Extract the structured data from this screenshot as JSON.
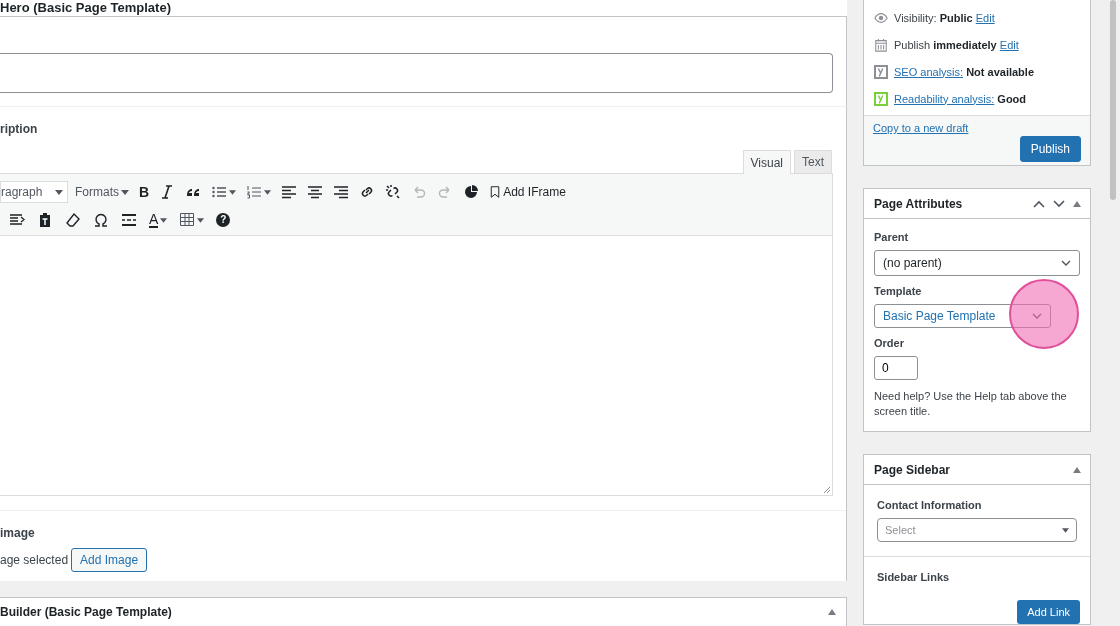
{
  "hero_section": {
    "title": "Hero (Basic Page Template)"
  },
  "description_field": {
    "label": "ription",
    "tabs": [
      {
        "label": "Visual",
        "selected": true
      },
      {
        "label": "Text",
        "selected": false
      }
    ],
    "format_select": "ragraph",
    "formats_menu": "Formats",
    "add_iframe": "Add IFrame",
    "toolbar_rows": [
      [
        {
          "kind": "bold",
          "label": "B",
          "disabled": false
        },
        {
          "kind": "italic",
          "disabled": false
        },
        {
          "kind": "quote",
          "disabled": false
        },
        {
          "kind": "bullets",
          "disabled": false
        },
        {
          "kind": "numbers",
          "disabled": false
        },
        {
          "kind": "align-left",
          "disabled": false
        },
        {
          "kind": "align-center",
          "disabled": false
        },
        {
          "kind": "align-right",
          "disabled": false
        },
        {
          "kind": "link",
          "disabled": false
        },
        {
          "kind": "unlink",
          "disabled": false
        },
        {
          "kind": "undo",
          "disabled": true
        },
        {
          "kind": "redo",
          "disabled": true
        },
        {
          "kind": "chart",
          "disabled": false
        }
      ],
      [
        {
          "kind": "indent",
          "disabled": false
        },
        {
          "kind": "paste",
          "disabled": false
        },
        {
          "kind": "eraser",
          "disabled": false
        },
        {
          "kind": "omega",
          "disabled": false
        },
        {
          "kind": "more",
          "disabled": false
        },
        {
          "kind": "text-color",
          "label": "A",
          "disabled": false
        },
        {
          "kind": "table",
          "disabled": false
        },
        {
          "kind": "help",
          "label": "?",
          "disabled": false
        }
      ]
    ]
  },
  "image_field": {
    "label": "image",
    "status": "age selected",
    "button": "Add Image"
  },
  "builder_section": {
    "title": "Builder (Basic Page Template)"
  },
  "publish_box": {
    "rows": [
      {
        "kind": "visibility",
        "text": "Visibility: **Public**",
        "link": "Edit"
      },
      {
        "kind": "schedule",
        "text": "Publish **immediately**",
        "link": "Edit"
      },
      {
        "kind": "seo",
        "link": "SEO analysis:",
        "value": "Not available",
        "color": "#8c8f94"
      },
      {
        "kind": "seo",
        "link": "Readability analysis:",
        "value": "Good",
        "color": "#7ad03a"
      }
    ],
    "copy_link": "Copy to a new draft",
    "button": "Publish"
  },
  "page_attributes": {
    "title": "Page Attributes",
    "parent_label": "Parent",
    "parent_value": "(no parent)",
    "template_label": "Template",
    "template_value": "Basic Page Template",
    "order_label": "Order",
    "order_value": "0",
    "help": "Need help? Use the Help tab above the screen title."
  },
  "page_sidebar": {
    "title": "Page Sidebar",
    "contact_label": "Contact Information",
    "contact_placeholder": "Select",
    "links_label": "Sidebar Links",
    "button": "Add Link"
  }
}
